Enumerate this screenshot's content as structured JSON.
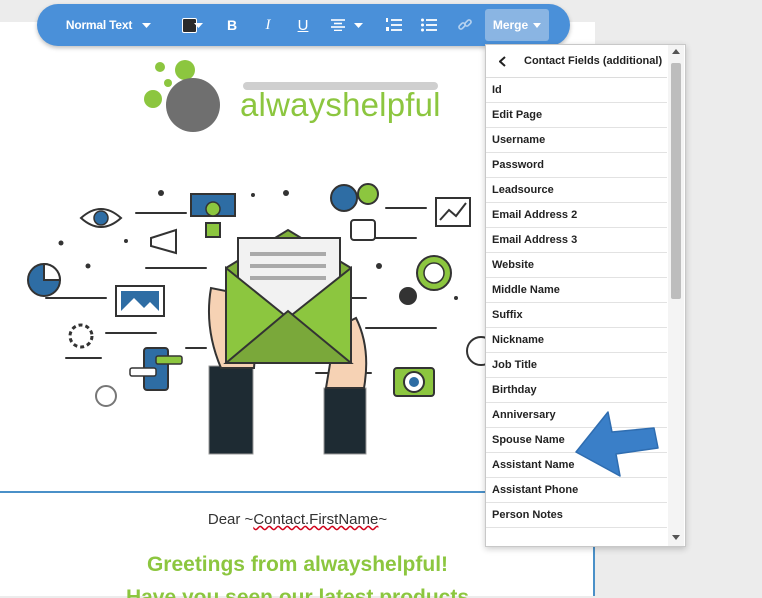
{
  "toolbar": {
    "text_style": "Normal Text",
    "bold": "B",
    "italic": "I",
    "underline": "U",
    "merge_label": "Merge"
  },
  "logo": {
    "brand_text": "alwayshelpful"
  },
  "email": {
    "greeting_prefix": "Dear ~",
    "greeting_tag": "Contact.FirstName",
    "greeting_suffix": "~",
    "headline": "Greetings from alwayshelpful!",
    "subline": "Have you seen our latest products"
  },
  "merge_panel": {
    "title": "Contact Fields (additional)",
    "items": [
      {
        "label": "Id"
      },
      {
        "label": "Edit Page"
      },
      {
        "label": "Username"
      },
      {
        "label": "Password"
      },
      {
        "label": "Leadsource"
      },
      {
        "label": "Email Address 2"
      },
      {
        "label": "Email Address 3"
      },
      {
        "label": "Website"
      },
      {
        "label": "Middle Name"
      },
      {
        "label": "Suffix"
      },
      {
        "label": "Nickname"
      },
      {
        "label": "Job Title"
      },
      {
        "label": "Birthday"
      },
      {
        "label": "Anniversary"
      },
      {
        "label": "Spouse Name"
      },
      {
        "label": "Assistant Name"
      },
      {
        "label": "Assistant Phone"
      },
      {
        "label": "Person Notes"
      }
    ]
  },
  "colors": {
    "toolbar_bg": "#4a90d9",
    "brand_green": "#8cc63f",
    "arrow_blue": "#3a7fc8"
  }
}
